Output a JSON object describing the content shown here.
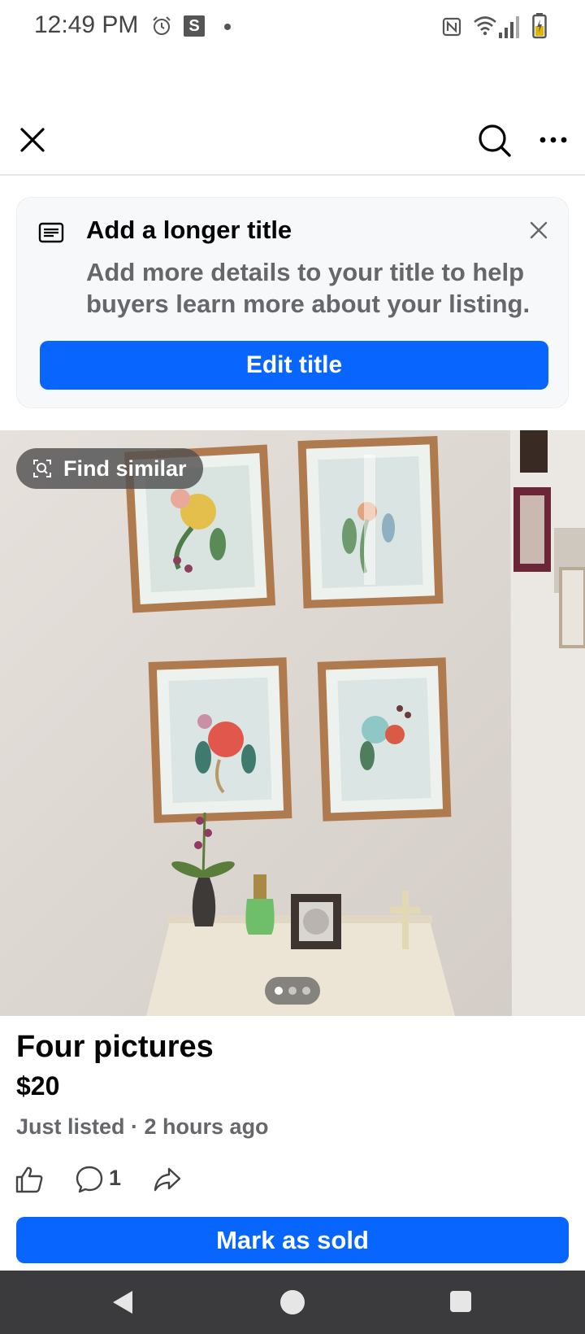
{
  "status_bar": {
    "time": "12:49 PM",
    "notification_letter": "S"
  },
  "header": {
    "close_icon": "close-icon",
    "search_icon": "search-icon",
    "more_icon": "more-horizontal-icon"
  },
  "tip": {
    "title": "Add a longer title",
    "body": "Add more details to your title to help buyers learn more about your listing.",
    "button_label": "Edit title"
  },
  "photo": {
    "find_similar_label": "Find similar",
    "page_count": 3,
    "current_page": 1
  },
  "listing": {
    "title": "Four pictures",
    "price": "$20",
    "meta": "Just listed · 2 hours ago",
    "comment_count": "1"
  },
  "actions": {
    "primary_label": "Mark as sold"
  },
  "colors": {
    "accent": "#0866ff",
    "secondary_text": "#65676b",
    "nav_bar": "#3b3b3d"
  }
}
